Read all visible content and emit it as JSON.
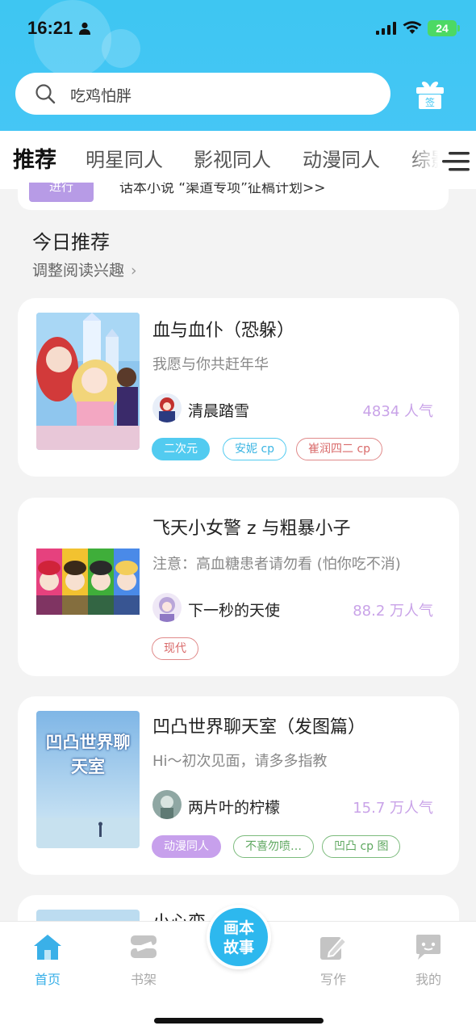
{
  "status": {
    "time": "16:21",
    "battery": "24"
  },
  "search": {
    "placeholder": "吃鸡怕胖",
    "gift_label": "签"
  },
  "tabs": [
    {
      "label": "推荐",
      "active": true
    },
    {
      "label": "明星同人"
    },
    {
      "label": "影视同人"
    },
    {
      "label": "动漫同人"
    },
    {
      "label": "综影"
    }
  ],
  "banner": {
    "tag": "进行",
    "text": "话本小说 “渠道专项”征稿计划>>"
  },
  "section": {
    "title": "今日推荐",
    "subtitle": "调整阅读兴趣"
  },
  "books": [
    {
      "title": "血与血仆（恐躲）",
      "desc": "我愿与你共赶年华",
      "author": "清晨踏雪",
      "popularity": "4834 人气",
      "tags": [
        {
          "label": "二次元",
          "style": "filled-cyan"
        },
        {
          "label": "安妮 cp",
          "style": "outline-cyan"
        },
        {
          "label": "崔润四二 cp",
          "style": "outline-red"
        }
      ]
    },
    {
      "title": "飞天小女警 z 与粗暴小子",
      "desc": "注意：高血糖患者请勿看 (怕你吃不消)",
      "author": "下一秒的天使",
      "popularity": "88.2 万人气",
      "tags": [
        {
          "label": "现代",
          "style": "outline-red"
        }
      ]
    },
    {
      "title": "凹凸世界聊天室（发图篇）",
      "desc": "Hi～初次见面，请多多指教",
      "author": "两片叶的柠檬",
      "popularity": "15.7 万人气",
      "cover_text": "凹凸世界聊天室",
      "tags": [
        {
          "label": "动漫同人",
          "style": "filled-purple"
        },
        {
          "label": "不喜勿喷…",
          "style": "outline-green"
        },
        {
          "label": "凹凸 cp 图",
          "style": "outline-green"
        }
      ]
    },
    {
      "title": "小心变",
      "title_tail": "生"
    }
  ],
  "nav": [
    {
      "label": "首页",
      "icon": "home-icon",
      "active": true
    },
    {
      "label": "书架",
      "icon": "bookshelf-icon"
    },
    {
      "label": "写作",
      "icon": "write-icon"
    },
    {
      "label": "我的",
      "icon": "profile-icon"
    }
  ],
  "center_button": {
    "line1": "画本",
    "line2": "故事"
  },
  "colors": {
    "accent": "#3ec6f2",
    "popularity": "#c9a3e8"
  }
}
